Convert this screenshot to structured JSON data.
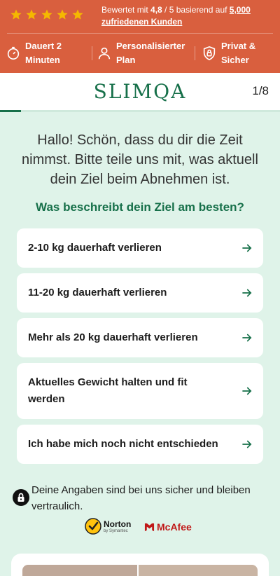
{
  "promo": {
    "stars": 5,
    "rating_prefix": "Bewertet mit ",
    "rating_value": "4,8",
    "rating_middle": " / 5 basierend auf ",
    "rating_count": "5,000",
    "rating_suffix": "zufriedenen Kunden",
    "features": [
      {
        "icon": "stopwatch-icon",
        "label": "Dauert 2 Minuten"
      },
      {
        "icon": "person-icon",
        "label": "Personalisierter Plan"
      },
      {
        "icon": "lock-shield-icon",
        "label": "Privat & Sicher"
      }
    ],
    "colors": {
      "background": "#d95f3e",
      "stars": "#f5b800"
    }
  },
  "header": {
    "logo": "SLIMQA",
    "step": "1/8",
    "progress_fraction": 0.075,
    "colors": {
      "brand": "#17704a"
    }
  },
  "main": {
    "intro": "Hallo! Schön, dass du dir die Zeit nimmst. Bitte teile uns mit, was aktuell dein Ziel beim Abnehmen ist.",
    "question": "Was beschreibt dein Ziel am besten?",
    "options": [
      "2-10 kg dauerhaft verlieren",
      "11-20 kg dauerhaft verlieren",
      "Mehr als 20 kg dauerhaft verlieren",
      "Aktuelles Gewicht halten und fit werden",
      "Ich habe mich noch nicht entschieden"
    ],
    "privacy": "Deine Angaben sind bei uns sicher und bleiben vertraulich.",
    "badges": {
      "norton": "Norton",
      "norton_sub": "by Symantec",
      "mcafee": "McAfee"
    },
    "colors": {
      "background": "#dff3e9"
    }
  }
}
